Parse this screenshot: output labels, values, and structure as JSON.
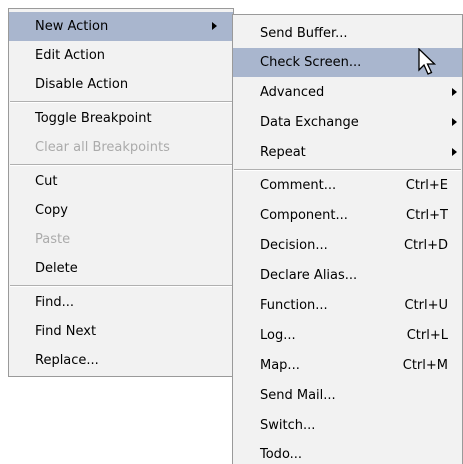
{
  "left_menu": {
    "new_action": "New Action",
    "edit_action": "Edit Action",
    "disable_action": "Disable Action",
    "toggle_breakpoint": "Toggle Breakpoint",
    "clear_all_breakpoints": "Clear all Breakpoints",
    "cut": "Cut",
    "copy": "Copy",
    "paste": "Paste",
    "delete": "Delete",
    "find": "Find...",
    "find_next": "Find Next",
    "replace": "Replace..."
  },
  "right_menu": {
    "send_buffer": "Send Buffer...",
    "check_screen": "Check Screen...",
    "advanced": "Advanced",
    "data_exchange": "Data Exchange",
    "repeat": "Repeat",
    "comment": {
      "label": "Comment...",
      "shortcut": "Ctrl+E"
    },
    "component": {
      "label": "Component...",
      "shortcut": "Ctrl+T"
    },
    "decision": {
      "label": "Decision...",
      "shortcut": "Ctrl+D"
    },
    "declare_alias": "Declare Alias...",
    "function": {
      "label": "Function...",
      "shortcut": "Ctrl+U"
    },
    "log": {
      "label": "Log...",
      "shortcut": "Ctrl+L"
    },
    "map": {
      "label": "Map...",
      "shortcut": "Ctrl+M"
    },
    "send_mail": "Send Mail...",
    "switch": "Switch...",
    "todo": "Todo..."
  },
  "colors": {
    "menu_background": "#f2f2f2",
    "highlight": "#a9b6ce",
    "disabled_text": "#ababab"
  },
  "icons": {
    "submenu": "submenu-arrow-icon",
    "cursor": "mouse-pointer-icon"
  }
}
